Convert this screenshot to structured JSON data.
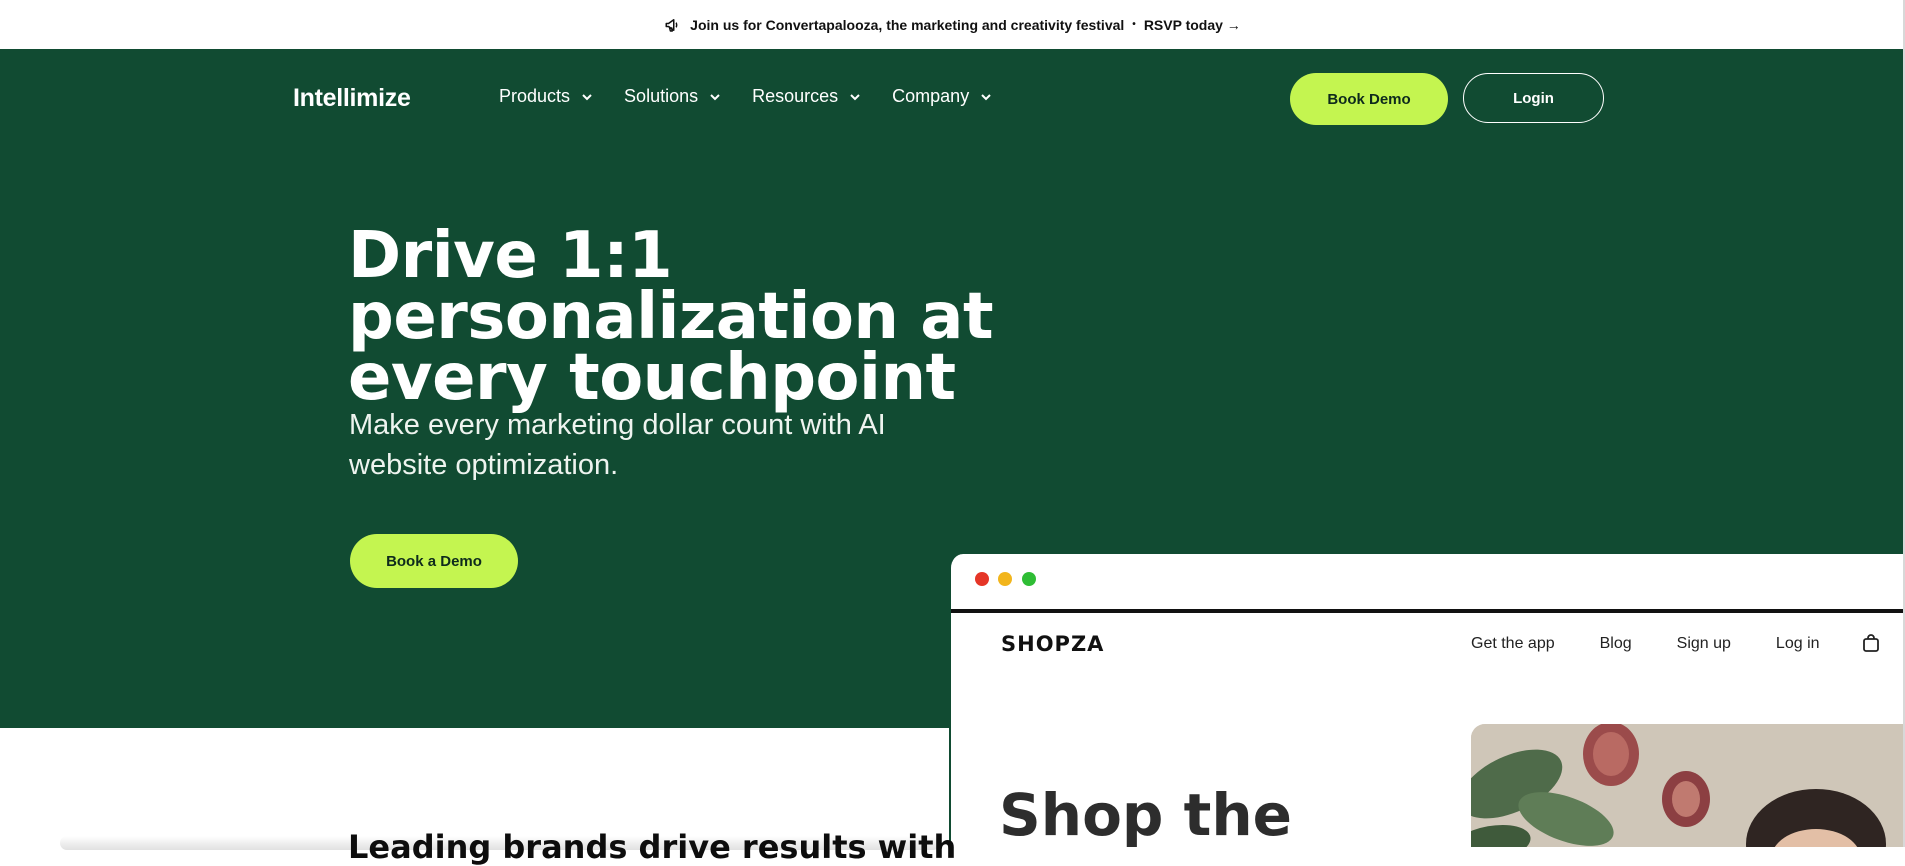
{
  "announcement": {
    "text": "Join us for Convertapalooza, the marketing and creativity festival",
    "bullet": "•",
    "link": "RSVP today →",
    "icon": "megaphone-icon"
  },
  "header": {
    "logo": "Intellimize",
    "nav": [
      "Products",
      "Solutions",
      "Resources",
      "Company"
    ],
    "book_demo": "Book Demo",
    "login": "Login"
  },
  "hero": {
    "headline": "Drive 1:1 personalization at every touchpoint",
    "subhead": "Make every marketing dollar count with AI website optimization.",
    "cta": "Book a Demo"
  },
  "mockup": {
    "brand": "SHOPZA",
    "nav": [
      "Get the app",
      "Blog",
      "Sign up",
      "Log in"
    ],
    "hero_text": "Shop the"
  },
  "below_fold": {
    "heading_partial": "Leading brands drive results with"
  },
  "colors": {
    "hero_bg": "#114b32",
    "accent": "#c4f550"
  }
}
